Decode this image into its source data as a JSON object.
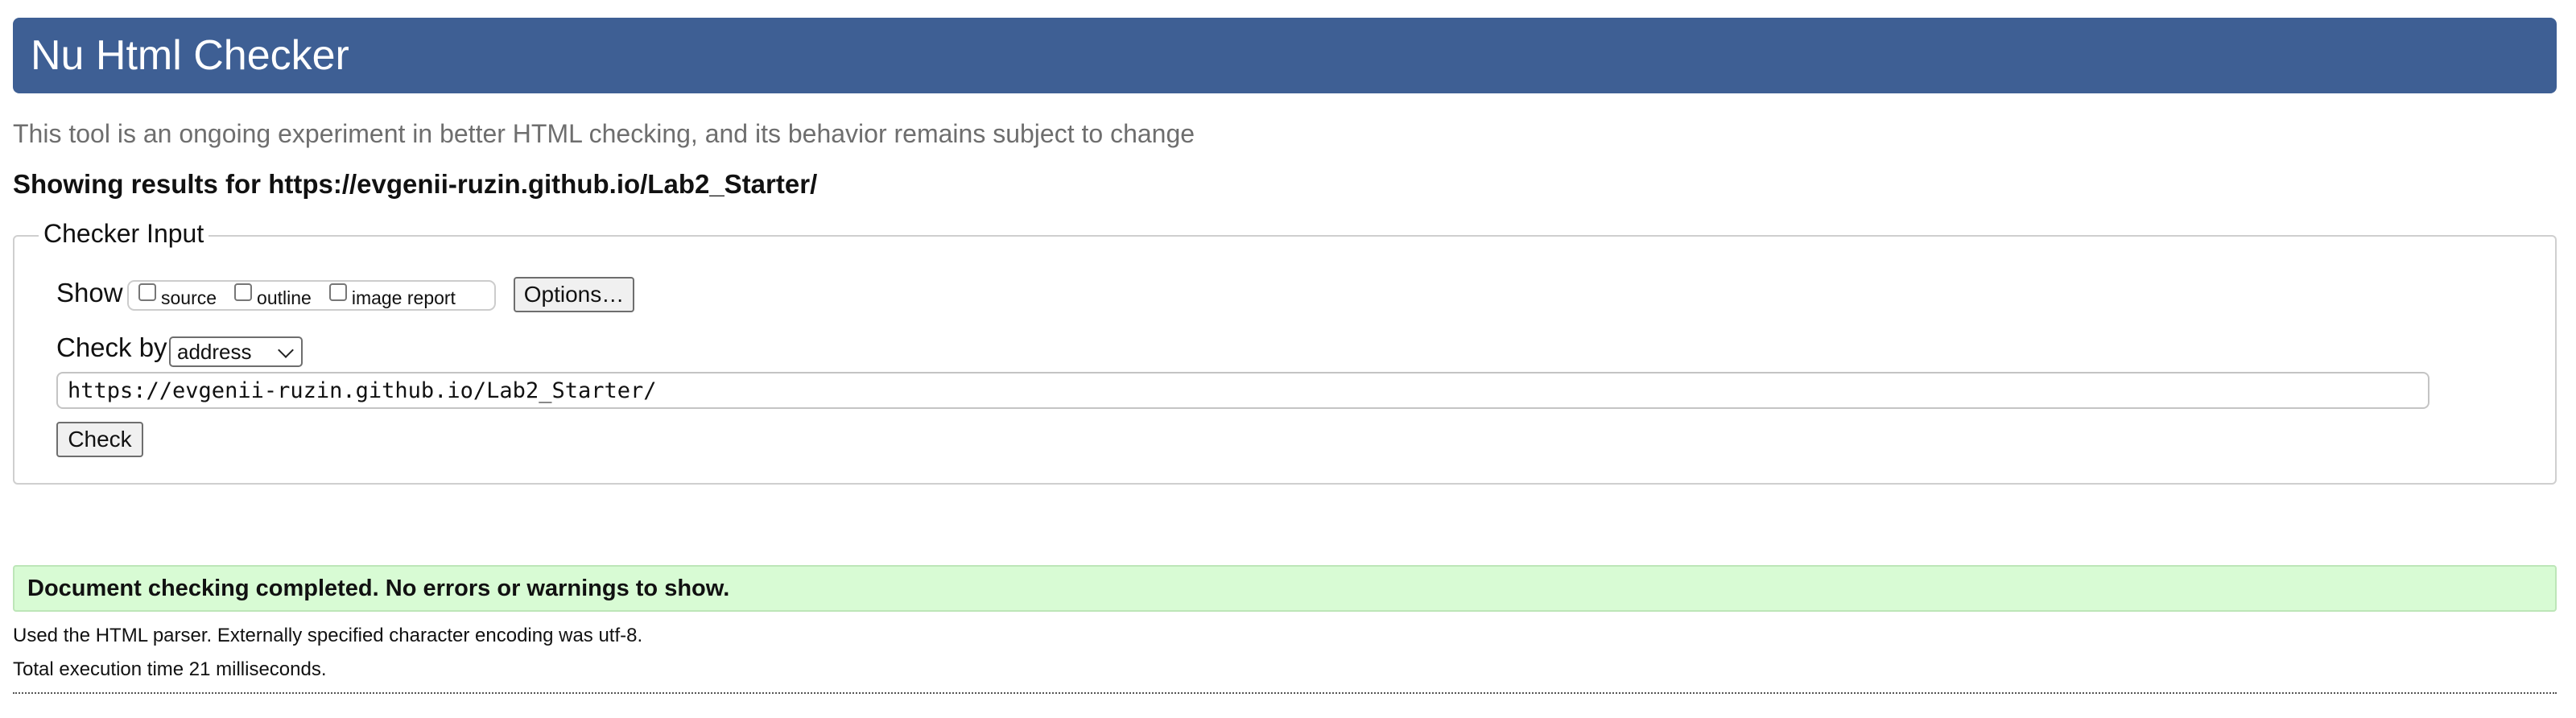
{
  "header": {
    "title": "Nu Html Checker"
  },
  "subtitle": "This tool is an ongoing experiment in better HTML checking, and its behavior remains subject to change",
  "results_heading": "Showing results for https://evgenii-ruzin.github.io/Lab2_Starter/",
  "checker_input": {
    "legend": "Checker Input",
    "show_label": "Show",
    "show_options": [
      {
        "label": "source",
        "checked": false
      },
      {
        "label": "outline",
        "checked": false
      },
      {
        "label": "image report",
        "checked": false
      }
    ],
    "options_button": "Options…",
    "check_by_label": "Check by",
    "check_by_selected": "address",
    "url_value": "https://evgenii-ruzin.github.io/Lab2_Starter/",
    "check_button": "Check"
  },
  "results": {
    "success_message": "Document checking completed. No errors or warnings to show.",
    "parser_info": "Used the HTML parser. Externally specified character encoding was utf-8.",
    "execution_time": "Total execution time 21 milliseconds."
  },
  "colors": {
    "header_bg": "#3e5f94",
    "success_bg": "#d8fbd4",
    "subtitle_text": "#6e6e6e"
  }
}
